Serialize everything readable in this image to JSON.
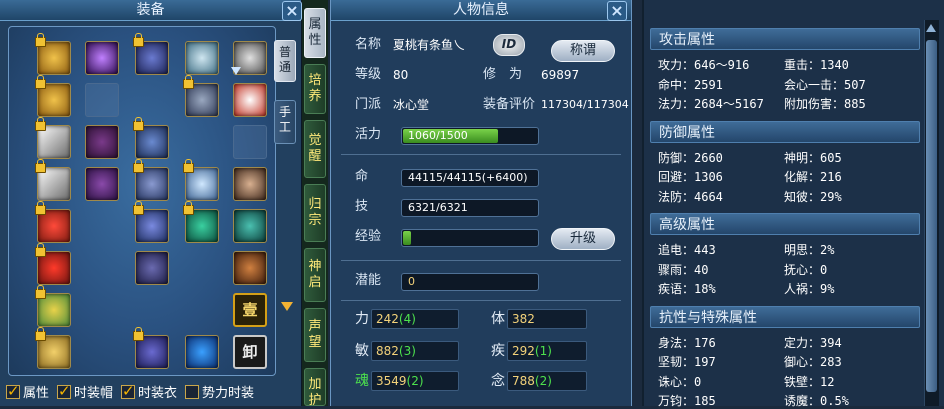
{
  "equipment": {
    "title": "装备",
    "tabs": [
      "普通",
      "手工"
    ],
    "badge_cn": "壹",
    "unload_cn": "卸",
    "checkboxes": [
      {
        "label": "属性",
        "checked": true
      },
      {
        "label": "时装帽",
        "checked": true
      },
      {
        "label": "时装衣",
        "checked": true
      },
      {
        "label": "势力时装",
        "checked": false
      }
    ]
  },
  "side_tabs": [
    "属性",
    "培养",
    "觉醒",
    "归宗",
    "神启",
    "声望",
    "加护"
  ],
  "info": {
    "title": "人物信息",
    "name_label": "名称",
    "name_value": "夏桃有条鱼乀",
    "id_label": "ID",
    "title_button": "称谓",
    "level_label": "等级",
    "level_value": "80",
    "cultivation_label": "修　为",
    "cultivation_value": "69897",
    "faction_label": "门派",
    "faction_value": "冰心堂",
    "rating_label": "装备评价",
    "rating_value": "117304/117304",
    "vitality_label": "活力",
    "vitality_value": "1060/1500",
    "vitality_fill": 0.71,
    "hp_label": "命",
    "hp_value": "44115/44115(+6400)",
    "skill_label": "技",
    "skill_value": "6321/6321",
    "exp_label": "经验",
    "exp_fill": 0.06,
    "upgrade_button": "升级",
    "potential_label": "潜能",
    "potential_value": "0",
    "stats": [
      {
        "label": "力",
        "base": "242",
        "bonus": "(4)"
      },
      {
        "label": "体",
        "base": "382",
        "bonus": ""
      },
      {
        "label": "敏",
        "base": "882",
        "bonus": "(3)"
      },
      {
        "label": "疾",
        "base": "292",
        "bonus": "(1)"
      },
      {
        "label": "魂",
        "base": "3549",
        "bonus": "(2)"
      },
      {
        "label": "念",
        "base": "788",
        "bonus": "(2)"
      }
    ]
  },
  "attributes": {
    "sections": [
      {
        "title": "攻击属性",
        "rows": [
          [
            "攻力：646～916",
            "重击：1340"
          ],
          [
            "命中：2591",
            "会心一击：507"
          ],
          [
            "法力：2684～5167",
            "附加伤害：885"
          ]
        ]
      },
      {
        "title": "防御属性",
        "rows": [
          [
            "防御：2660",
            "神明：605"
          ],
          [
            "回避：1306",
            "化解：216"
          ],
          [
            "法防：4664",
            "知彼：29%"
          ]
        ]
      },
      {
        "title": "高级属性",
        "rows": [
          [
            "追电：443",
            "明思：2%"
          ],
          [
            "骤雨：40",
            "抚心：0"
          ],
          [
            "疾语：18%",
            "人祸：9%"
          ]
        ]
      },
      {
        "title": "抗性与特殊属性",
        "rows": [
          [
            "身法：176",
            "定力：394"
          ],
          [
            "坚韧：197",
            "御心：283"
          ],
          [
            "诛心：0",
            "铁壁：12"
          ],
          [
            "万钧：185",
            "诱魔：0.5%"
          ]
        ]
      }
    ]
  },
  "colors": {
    "panel_bg": "#213d5c",
    "gold": "#f3d27a",
    "green": "#4de14d",
    "bar_green": "#3a8d1f"
  }
}
